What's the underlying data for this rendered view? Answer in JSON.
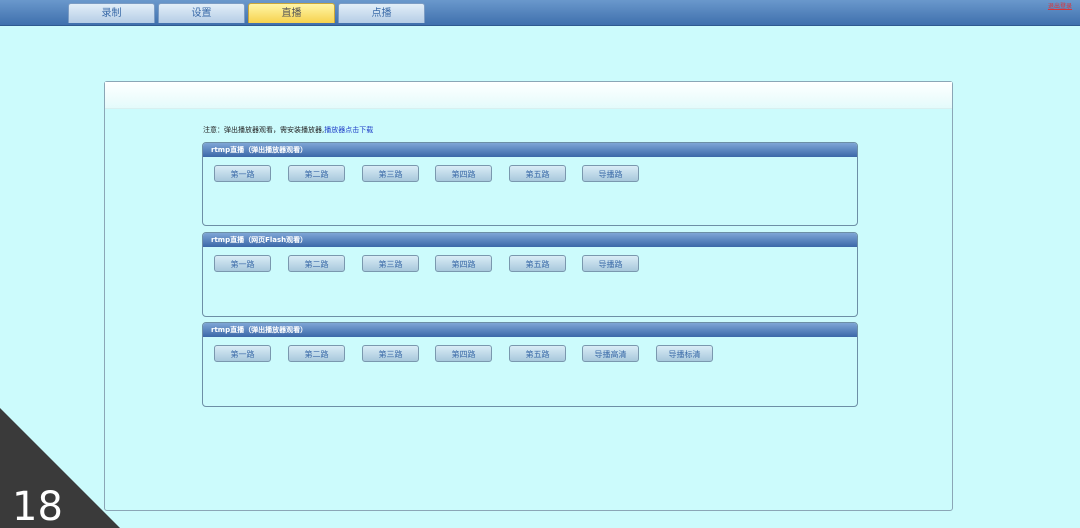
{
  "tabs": [
    {
      "label": "录制",
      "active": false
    },
    {
      "label": "设置",
      "active": false
    },
    {
      "label": "直播",
      "active": true
    },
    {
      "label": "点播",
      "active": false
    }
  ],
  "logout": "退出登录",
  "notice": {
    "text": "注意：弹出播放器观看，需安装播放器,",
    "link": "播放器点击下载"
  },
  "groups": [
    {
      "title": "rtmp直播（弹出播放器观看）",
      "buttons": [
        "第一路",
        "第二路",
        "第三路",
        "第四路",
        "第五路",
        "导播路"
      ]
    },
    {
      "title": "rtmp直播（网页Flash观看）",
      "buttons": [
        "第一路",
        "第二路",
        "第三路",
        "第四路",
        "第五路",
        "导播路"
      ]
    },
    {
      "title": "rtmp直播（弹出播放器观看）",
      "buttons": [
        "第一路",
        "第二路",
        "第三路",
        "第四路",
        "第五路",
        "导播高清",
        "导播标清"
      ]
    }
  ],
  "badge": "18",
  "colors": {
    "background": "#ccfbfc",
    "tabbar": "#3f70ad",
    "active_tab": "#f6d24e"
  }
}
